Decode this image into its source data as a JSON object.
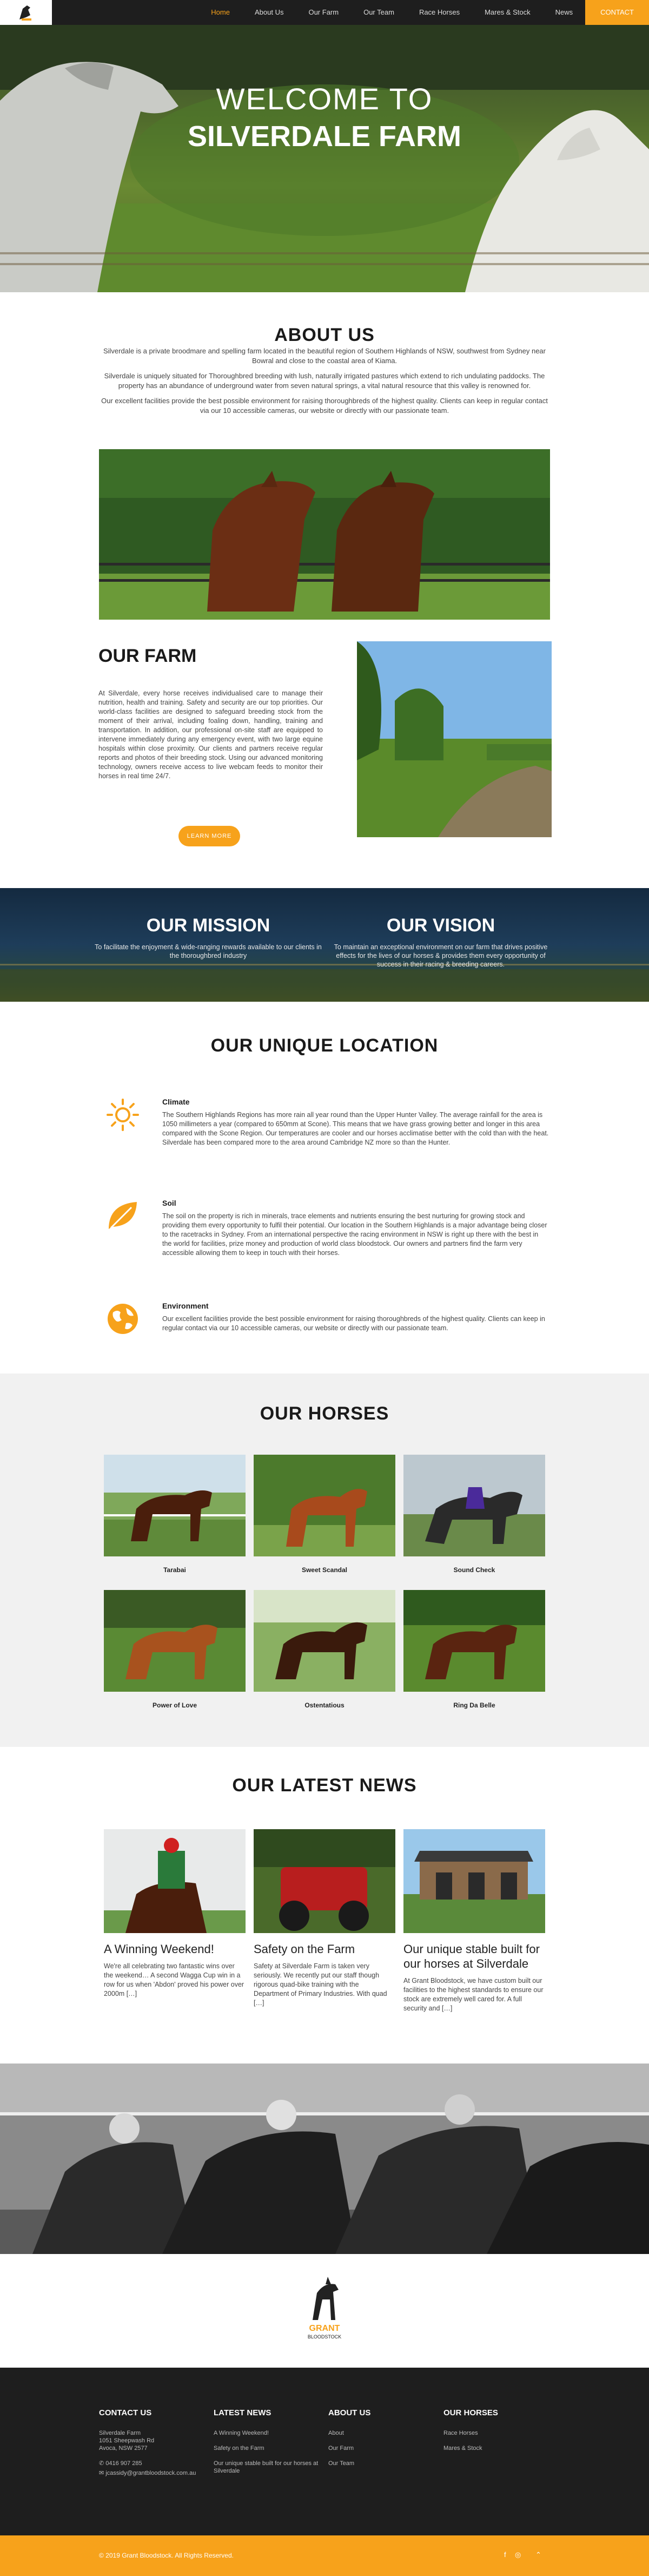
{
  "nav": {
    "items": [
      "Home",
      "About Us",
      "Our Farm",
      "Our Team",
      "Race Horses",
      "Mares & Stock",
      "News",
      "CONTACT"
    ]
  },
  "hero": {
    "line1": "WELCOME TO",
    "line2": "SILVERDALE FARM"
  },
  "about": {
    "title": "ABOUT US",
    "paragraphs": [
      "Silverdale is a private broodmare and spelling farm located in the beautiful region of Southern Highlands of NSW, southwest from Sydney near Bowral and close to the coastal area of Kiama.",
      "Silverdale is uniquely situated for Thoroughbred breeding with lush, naturally irrigated pastures which extend to rich undulating paddocks. The property has an abundance of underground water from seven natural springs, a vital natural resource that this valley is renowned for.",
      "Our excellent facilities provide the best possible environment for raising thoroughbreds of the highest quality. Clients can keep in regular contact via our 10 accessible cameras, our website or directly with our passionate team."
    ]
  },
  "farm": {
    "title": "OUR FARM",
    "text": "At Silverdale, every horse receives individualised care to manage their nutrition, health and training. Safety and security are our top priorities. Our world-class facilities are designed to safeguard breeding stock from the moment of their arrival, including foaling down, handling, training and transportation. In addition, our professional on-site staff are equipped to intervene immediately during any emergency event, with two large equine hospitals within close proximity. Our clients and partners receive regular reports and photos of their breeding stock. Using our advanced monitoring technology, owners receive access to live webcam feeds to monitor their horses in real time 24/7.",
    "button": "LEARN MORE"
  },
  "mission": {
    "title": "OUR MISSION",
    "text": "To facilitate the enjoyment & wide-ranging rewards available to our clients in the thoroughbred industry"
  },
  "vision": {
    "title": "OUR VISION",
    "text": "To maintain an exceptional environment on our farm that drives positive effects for the lives of our horses & provides them every opportunity of success in their racing & breeding careers."
  },
  "location": {
    "title": "OUR UNIQUE LOCATION",
    "items": [
      {
        "heading": "Climate",
        "icon": "sun-icon",
        "text": "The Southern Highlands Regions has more rain all year round than the Upper Hunter Valley. The average rainfall for the area is 1050 millimeters a year (compared to 650mm at Scone). This means that we have grass growing better and longer in this area compared with the Scone Region. Our temperatures are cooler and our horses acclimatise better with the cold than with the heat. Silverdale has been compared more to the area around Cambridge NZ more so than the Hunter."
      },
      {
        "heading": "Soil",
        "icon": "leaf-icon",
        "text": "The soil on the property is rich in minerals, trace elements and nutrients ensuring the best nurturing for growing stock and providing them every opportunity to fulfil their potential. Our location in the Southern Highlands is a major advantage being closer to the racetracks in Sydney. From an international perspective the racing environment in NSW is right up there with the best in the world for facilities, prize money and production of world class bloodstock. Our owners and partners find the farm very accessible allowing them to keep in touch with their horses."
      },
      {
        "heading": "Environment",
        "icon": "globe-icon",
        "text": "Our excellent facilities provide the best possible environment for raising thoroughbreds of the highest quality. Clients can keep in regular contact via our 10 accessible cameras, our website or directly with our passionate team."
      }
    ]
  },
  "horses": {
    "title": "OUR HORSES",
    "items": [
      "Tarabai",
      "Sweet Scandal",
      "Sound Check",
      "Power of Love",
      "Ostentatious",
      "Ring Da Belle"
    ]
  },
  "news": {
    "title": "OUR LATEST NEWS",
    "items": [
      {
        "title": "A Winning Weekend!",
        "text": "We're all celebrating two fantastic wins over the weekend… A second Wagga Cup win in a row for us when 'Abdon' proved his power over 2000m […]"
      },
      {
        "title": "Safety on the Farm",
        "text": "Safety at Silverdale Farm is taken very seriously. We recently put our staff though rigorous quad-bike training with the Department of Primary Industries. With quad […]"
      },
      {
        "title": "Our unique stable built for our horses at Silverdale",
        "text": "At Grant Bloodstock, we have custom built our facilities to the highest standards to ensure our stock are extremely well cared for. A full security and […]"
      }
    ]
  },
  "logo": {
    "line1": "GRANT",
    "line2": "BLOODSTOCK"
  },
  "footer": {
    "contact": {
      "title": "CONTACT US",
      "address": [
        "Silverdale Farm",
        "1051 Sheepwash Rd",
        "Avoca, NSW 2577"
      ],
      "phone": "0416 907 285",
      "email": "jcassidy@grantbloodstock.com.au"
    },
    "latest_news": {
      "title": "LATEST NEWS",
      "items": [
        "A Winning Weekend!",
        "Safety on the Farm",
        "Our unique stable built for our horses at Silverdale"
      ]
    },
    "about": {
      "title": "ABOUT US",
      "items": [
        "About",
        "Our Farm",
        "Our Team"
      ]
    },
    "our_horses": {
      "title": "OUR HORSES",
      "items": [
        "Race Horses",
        "Mares & Stock"
      ]
    },
    "copyright": "© 2019 Grant Bloodstock. All Rights Reserved."
  },
  "colors": {
    "accent": "#f7a21b",
    "dark": "#1e1e1e"
  }
}
